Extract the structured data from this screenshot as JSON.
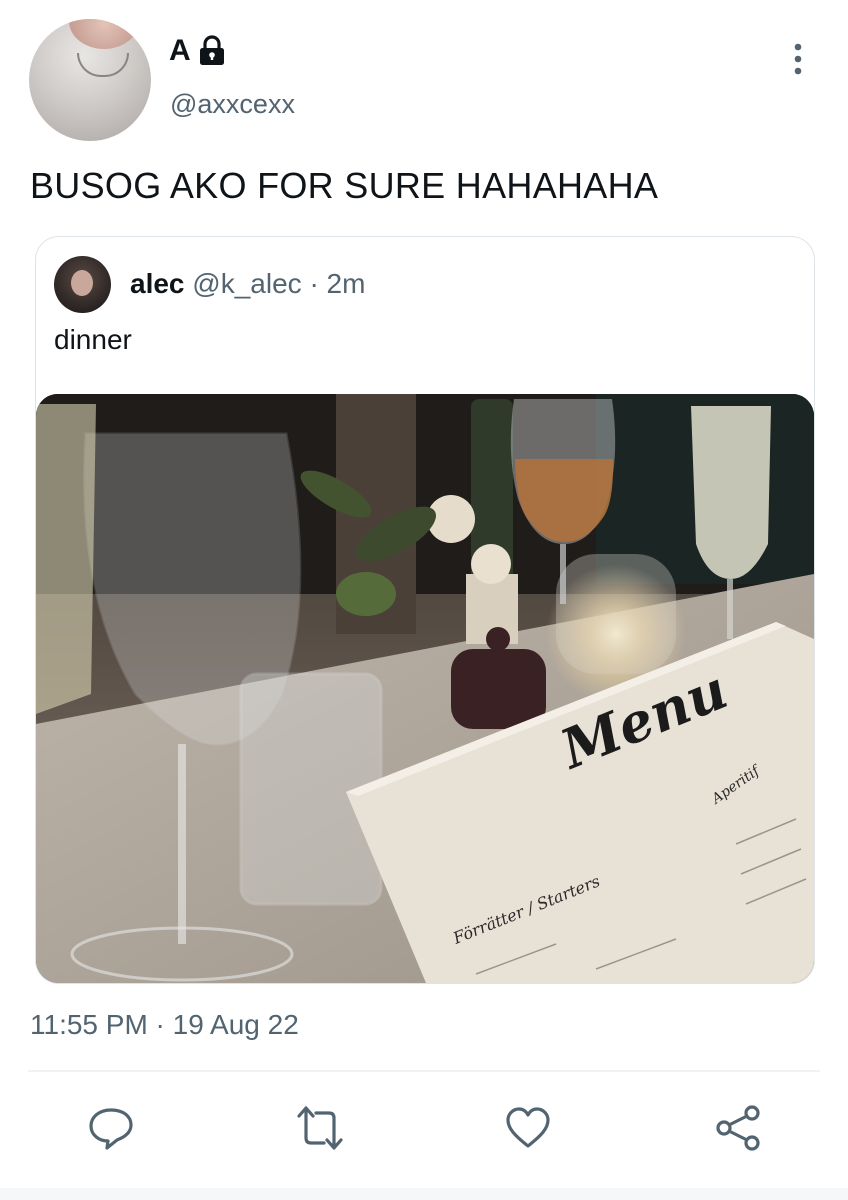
{
  "tweet": {
    "display_name": "A",
    "handle": "@axxcexx",
    "text": "BUSOG AKO FOR SURE HAHAHAHA",
    "timestamp": "11:55 PM · 19 Aug 22",
    "protected_icon": "lock-icon",
    "more_icon": "more-vertical-icon"
  },
  "quoted": {
    "display_name": "alec",
    "handle": "@k_alec",
    "separator": "·",
    "time": "2m",
    "text": "dinner",
    "media": {
      "menu_title": "Menu",
      "menu_section_left": "Förrätter / Starters",
      "menu_section_right": "Aperitif"
    }
  },
  "actions": [
    {
      "name": "reply",
      "icon": "reply-icon"
    },
    {
      "name": "retweet",
      "icon": "retweet-icon"
    },
    {
      "name": "like",
      "icon": "heart-icon"
    },
    {
      "name": "share",
      "icon": "share-icon"
    }
  ],
  "colors": {
    "text_primary": "#0f1419",
    "text_secondary": "#536471",
    "border": "#dde3e7"
  }
}
